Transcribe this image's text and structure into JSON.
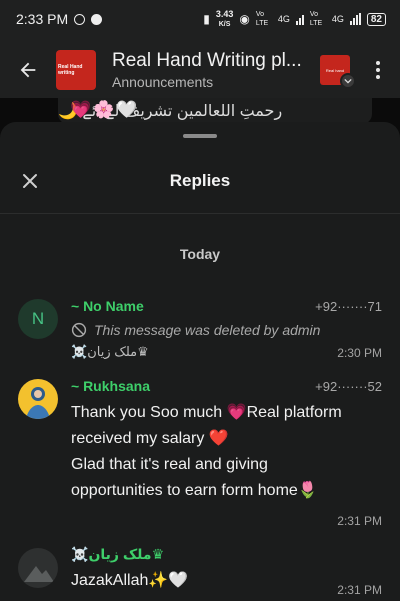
{
  "status_bar": {
    "time": "2:33 PM",
    "net_speed_value": "3.43",
    "net_speed_unit": "K/S",
    "lte1": "Vo LTE",
    "net1": "4G",
    "lte2": "Vo LTE",
    "net2": "4G",
    "battery": "82"
  },
  "header": {
    "title": "Real Hand Writing pl...",
    "subtitle": "Announcements",
    "avatar_text": "Real Hand writing",
    "badge_text": "Real hand"
  },
  "peek": {
    "text": "رحمتِ اللعالمین تشریف لے ائے 🌙",
    "emoji": "💗🌸🤍"
  },
  "sheet": {
    "title": "Replies",
    "day_label": "Today"
  },
  "replies": [
    {
      "avatar_letter": "N",
      "name": "~ No Name",
      "phone": "+92·······71",
      "deleted_text": "This message was deleted by admin",
      "sender": "☠️ملک زیان♛",
      "time": "2:30 PM"
    },
    {
      "name": "~ Rukhsana",
      "phone": "+92·······52",
      "text_lines": [
        "Thank you Soo much 💗Real platform",
        "received my salary ❤️",
        "Glad that it's real and giving",
        "opportunities to earn form home🌷"
      ],
      "time": "2:31 PM"
    },
    {
      "name": "☠️ملک زیان♛",
      "text": "JazakAllah✨🤍",
      "time": "2:31 PM"
    }
  ],
  "colors": {
    "accent_green": "#3ecf6a",
    "brand_red": "#c4261d",
    "sheet_bg": "#1b1c1c"
  },
  "icons": {
    "back": "arrow-left-icon",
    "close": "close-icon",
    "deleted": "block-icon",
    "menu": "more-vert-icon"
  }
}
